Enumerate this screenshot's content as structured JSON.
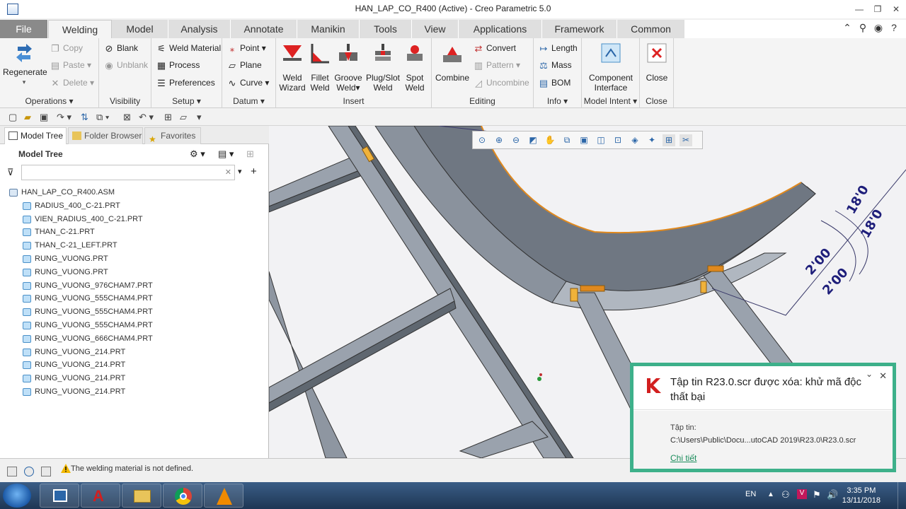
{
  "window": {
    "title": "HAN_LAP_CO_R400 (Active) - Creo Parametric 5.0",
    "minimize": "—",
    "restore": "❐",
    "close": "✕"
  },
  "tabs": [
    "File",
    "Welding",
    "Model",
    "Analysis",
    "Annotate",
    "Manikin",
    "Tools",
    "View",
    "Applications",
    "Framework",
    "Common"
  ],
  "ribbon": {
    "regenerate": "Regenerate",
    "copy": "Copy",
    "paste": "Paste",
    "delete": "Delete",
    "operations": "Operations",
    "blank": "Blank",
    "unblank": "Unblank",
    "visibility": "Visibility",
    "weld_material": "Weld Material",
    "process": "Process",
    "preferences": "Preferences",
    "setup": "Setup",
    "point": "Point",
    "plane": "Plane",
    "curve": "Curve",
    "datum": "Datum",
    "weld_wizard": [
      "Weld",
      "Wizard"
    ],
    "fillet_weld": [
      "Fillet",
      "Weld"
    ],
    "groove_weld": [
      "Groove",
      "Weld"
    ],
    "plug_slot_weld": [
      "Plug/Slot",
      "Weld"
    ],
    "spot_weld": [
      "Spot",
      "Weld"
    ],
    "insert": "Insert",
    "combine": "Combine",
    "convert": "Convert",
    "pattern": "Pattern",
    "uncombine": "Uncombine",
    "editing": "Editing",
    "length": "Length",
    "mass": "Mass",
    "bom": "BOM",
    "info": "Info",
    "component_interface": [
      "Component",
      "Interface"
    ],
    "model_intent": "Model Intent",
    "close_btn": "Close",
    "close_group": "Close"
  },
  "panel": {
    "tabs": [
      "Model Tree",
      "Folder Browser",
      "Favorites"
    ],
    "header": "Model Tree",
    "filter_placeholder": "",
    "tree": [
      "HAN_LAP_CO_R400.ASM",
      "RADIUS_400_C-21.PRT",
      "VIEN_RADIUS_400_C-21.PRT",
      "THAN_C-21.PRT",
      "THAN_C-21_LEFT.PRT",
      "RUNG_VUONG.PRT",
      "RUNG_VUONG.PRT",
      "RUNG_VUONG_976CHAM7.PRT",
      "RUNG_VUONG_555CHAM4.PRT",
      "RUNG_VUONG_555CHAM4.PRT",
      "RUNG_VUONG_555CHAM4.PRT",
      "RUNG_VUONG_666CHAM4.PRT",
      "RUNG_VUONG_214.PRT",
      "RUNG_VUONG_214.PRT",
      "RUNG_VUONG_214.PRT",
      "RUNG_VUONG_214.PRT"
    ]
  },
  "viewport": {
    "dimensions": [
      "18'0",
      "18'0",
      "2'00",
      "2'00"
    ]
  },
  "status": {
    "message": "The welding material is not defined."
  },
  "toast": {
    "title": "Tập tin R23.0.scr được xóa: khử mã độc thất bại",
    "label": "Tập tin:",
    "path": "C:\\Users\\Public\\Docu...utoCAD 2019\\R23.0\\R23.0.scr",
    "link": "Chi tiết"
  },
  "taskbar": {
    "lang": "EN",
    "time": "3:35 PM",
    "date": "13/11/2018"
  },
  "colors": {
    "accent": "#3db08a",
    "file_tab": "#8a8a8a",
    "taskbar": "#1e3654",
    "weld": "#e0891e"
  }
}
